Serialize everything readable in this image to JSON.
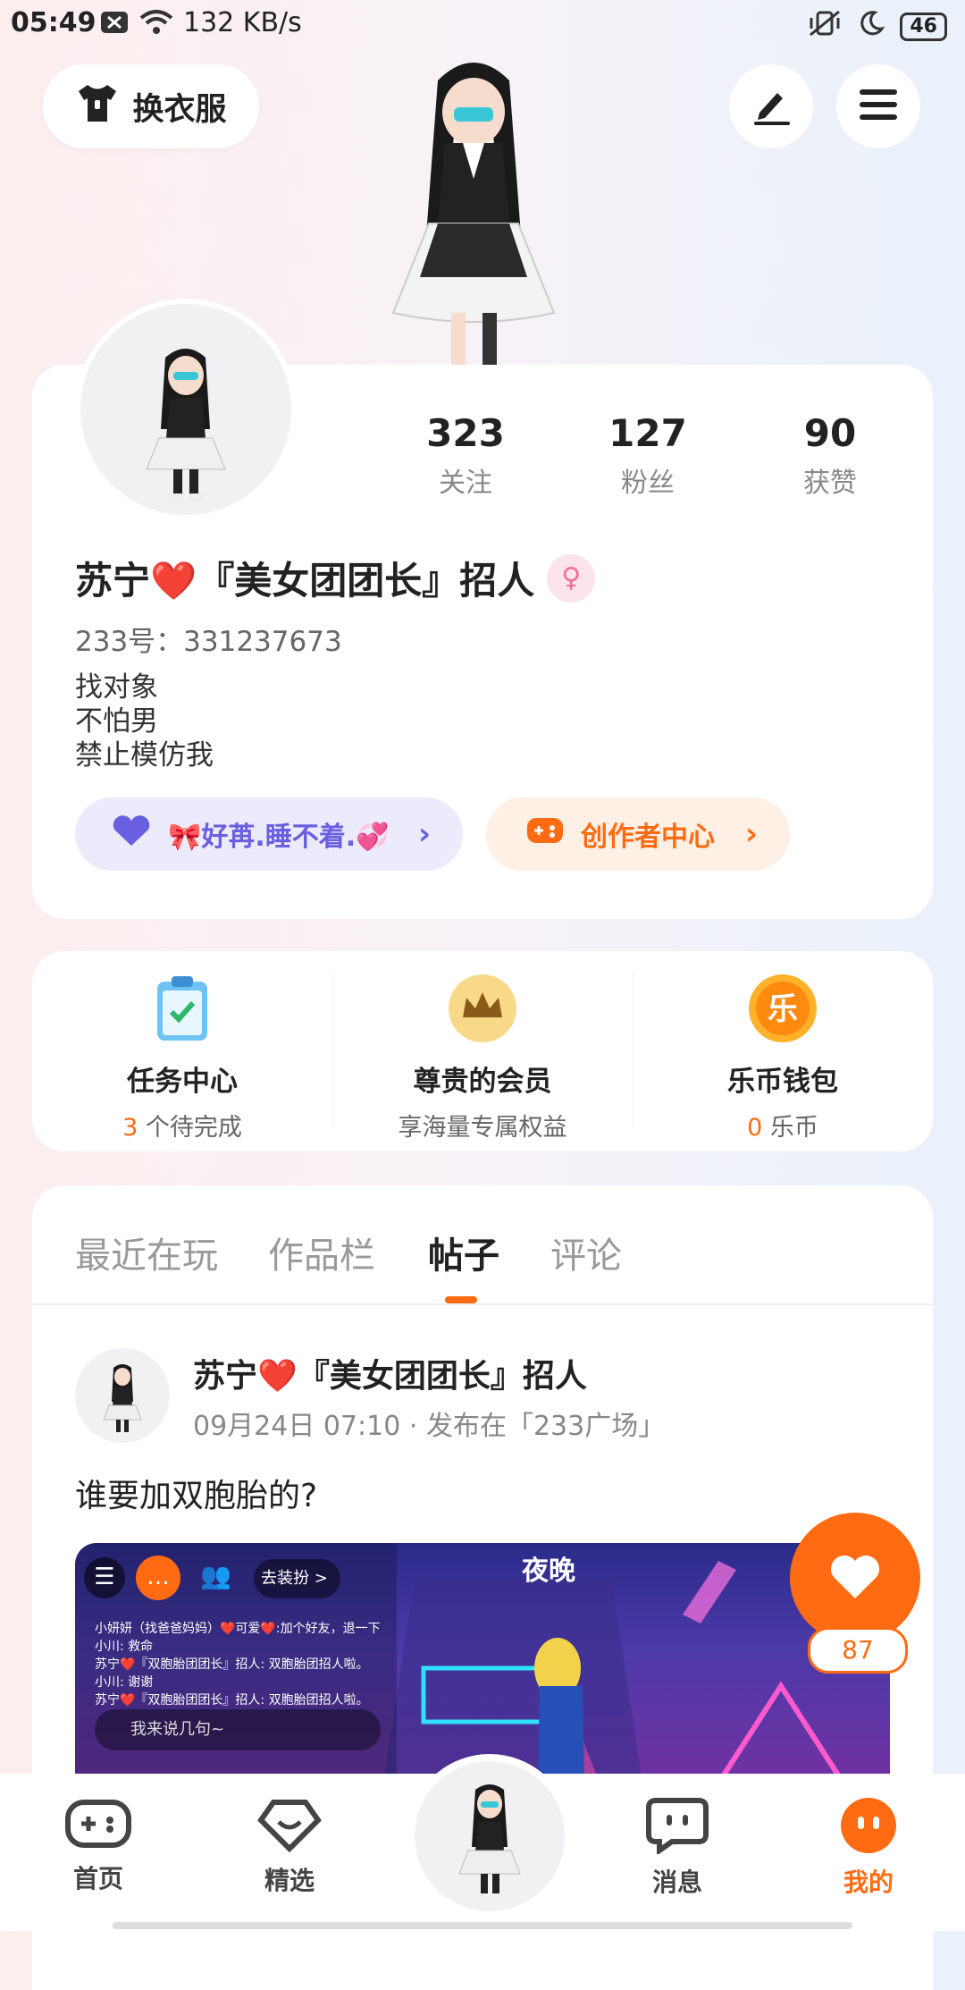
{
  "status_bar": {
    "time": "05:49",
    "speed": "132 KB/s",
    "battery": "46"
  },
  "top": {
    "outfit_label": "换衣服"
  },
  "profile": {
    "stats": [
      {
        "value": "323",
        "label": "关注"
      },
      {
        "value": "127",
        "label": "粉丝"
      },
      {
        "value": "90",
        "label": "获赞"
      }
    ],
    "nickname": "苏宁❤️『美女团团长』招人",
    "uid": "233号：331237673",
    "bio": [
      "找对象",
      "不怕男",
      "禁止模仿我"
    ],
    "group_label": "🎀好苒.睡不着.💞",
    "creator_label": "创作者中心"
  },
  "services": [
    {
      "title": "任务中心",
      "count": "3",
      "suffix": " 个待完成",
      "icon": "task-clipboard-icon"
    },
    {
      "title": "尊贵的会员",
      "sub": "享海量专属权益",
      "icon": "crown-icon"
    },
    {
      "title": "乐币钱包",
      "count": "0",
      "suffix": " 乐币",
      "icon": "le-coin-icon",
      "coin_char": "乐"
    }
  ],
  "tabs": [
    "最近在玩",
    "作品栏",
    "帖子",
    "评论"
  ],
  "active_tab": "帖子",
  "post": {
    "author": "苏宁❤️『美女团团长』招人",
    "meta": "09月24日 07:10 · 发布在「233广场」",
    "text": "谁要加双胞胎的?",
    "image_texts": {
      "night_sign": "夜晚",
      "dress_up": "去装扮 >",
      "chat_lines": [
        "小妍妍（找爸爸妈妈）❤️可爱❤️:加个好友，退一下",
        "小川: 救命",
        "苏宁❤️『双胞胎团团长』招人: 双胞胎团招人啦。",
        "小川: 谢谢",
        "苏宁❤️『双胞胎团团长』招人: 双胞胎团招人啦。"
      ],
      "chat_placeholder": "我来说几句~"
    }
  },
  "like": {
    "count": "87"
  },
  "bottom_nav": [
    {
      "label": "首页",
      "icon": "gamepad-icon"
    },
    {
      "label": "精选",
      "icon": "heart-diamond-icon"
    },
    {
      "label": "消息",
      "icon": "chat-bubble-icon"
    },
    {
      "label": "我的",
      "icon": "smile-face-icon"
    }
  ],
  "colors": {
    "accent": "#ff6b12",
    "group": "#6a5fe0"
  }
}
